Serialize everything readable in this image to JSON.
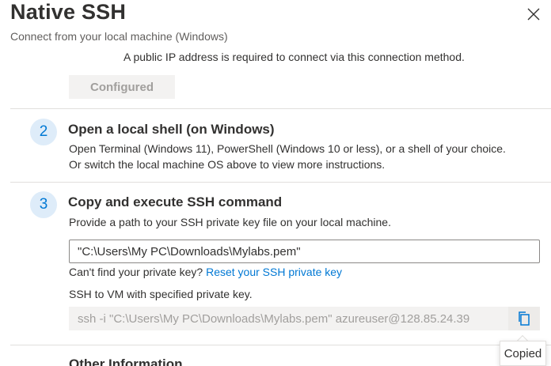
{
  "header": {
    "title": "Native SSH",
    "subtitle": "Connect from your local machine (Windows)"
  },
  "step1": {
    "info": "A public IP address is required to connect via this connection method.",
    "configured_label": "Configured"
  },
  "step2": {
    "number": "2",
    "title": "Open a local shell (on Windows)",
    "line1": "Open Terminal (Windows 11), PowerShell (Windows 10 or less), or a shell of your choice.",
    "line2": "Or switch the local machine OS above to view more instructions."
  },
  "step3": {
    "number": "3",
    "title": "Copy and execute SSH command",
    "description": "Provide a path to your SSH private key file on your local machine.",
    "key_path_value": "\"C:\\Users\\My PC\\Downloads\\Mylabs.pem\"",
    "cant_find": "Can't find your private key?",
    "reset_link": "Reset your SSH private key",
    "ssh_label": "SSH to VM with specified private key.",
    "command": "ssh -i \"C:\\Users\\My PC\\Downloads\\Mylabs.pem\" azureuser@128.85.24.39",
    "copied_tooltip": "Copied"
  },
  "next_section": {
    "title": "Other Information"
  },
  "icons": {
    "close": "close-icon",
    "copy": "copy-icon"
  },
  "colors": {
    "accent": "#0078d4",
    "badge_bg": "#deecf9",
    "disabled_text": "#a19f9d",
    "disabled_bg": "#f3f2f1"
  }
}
